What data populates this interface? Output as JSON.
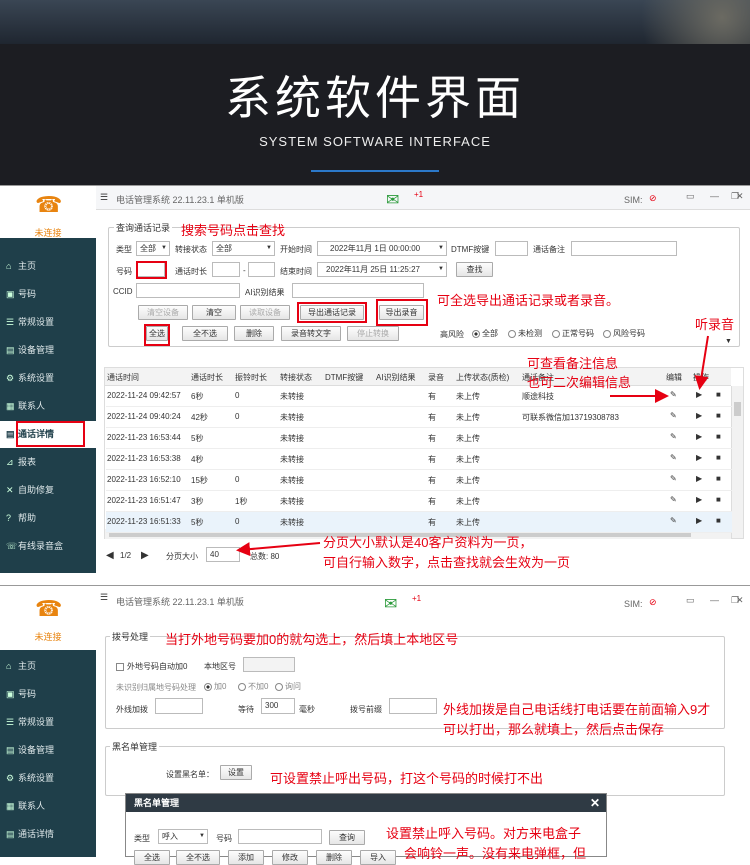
{
  "banner": {
    "title": "系统软件界面",
    "subtitle": "SYSTEM SOFTWARE INTERFACE"
  },
  "app": {
    "title": "电话管理系统  22.11.23.1  单机版",
    "msg_badge": "+1",
    "sim_label": "SIM:",
    "status": "未连接",
    "nav": [
      "主页",
      "号码",
      "常规设置",
      "设备管理",
      "系统设置",
      "联系人",
      "通话详情",
      "报表",
      "自助修复",
      "帮助",
      "有线录音盒"
    ]
  },
  "records": {
    "group_title": "查询通话记录",
    "type_label": "类型",
    "type_value": "全部",
    "transfer_label": "转接状态",
    "transfer_value": "全部",
    "start_label": "开始时间",
    "start_value": "2022年11月 1日 00:00:00",
    "dtmf_label": "DTMF按键",
    "note_label": "通话备注",
    "number_label": "号码",
    "duration_label": "通话时长",
    "dash": "-",
    "end_label": "结束时间",
    "end_value": "2022年11月 25日 11:25:27",
    "search_btn": "查找",
    "ccid_label": "CCID",
    "ai_label": "AI识别结果",
    "buttons": [
      "清空设备",
      "清空",
      "读取设备",
      "导出通话记录",
      "导出录音",
      "全选",
      "全不选",
      "删除",
      "录音转文字",
      "停止转换"
    ],
    "risk_label": "高风险",
    "risk_opts": [
      "全部",
      "未检测",
      "正常号码",
      "风险号码"
    ],
    "headers": [
      "通话时间",
      "通话时长",
      "振铃时长",
      "转接状态",
      "DTMF按键",
      "AI识别结果",
      "录音",
      "上传状态(质检)",
      "通话备注",
      "编辑",
      "操作"
    ],
    "rows": [
      [
        "2022-11-24 09:42:57",
        "6秒",
        "0",
        "未转接",
        "有",
        "未上传",
        "顺途科技"
      ],
      [
        "2022-11-24 09:40:24",
        "42秒",
        "0",
        "未转接",
        "有",
        "未上传",
        "可联系微信加13719308783"
      ],
      [
        "2022-11-23 16:53:44",
        "5秒",
        "",
        "未转接",
        "有",
        "未上传",
        ""
      ],
      [
        "2022-11-23 16:53:38",
        "4秒",
        "",
        "未转接",
        "有",
        "未上传",
        ""
      ],
      [
        "2022-11-23 16:52:10",
        "15秒",
        "0",
        "未转接",
        "有",
        "未上传",
        ""
      ],
      [
        "2022-11-23 16:51:47",
        "3秒",
        "1秒",
        "未转接",
        "有",
        "未上传",
        ""
      ],
      [
        "2022-11-23 16:51:33",
        "5秒",
        "0",
        "未转接",
        "有",
        "未上传",
        ""
      ]
    ],
    "page": "1/2",
    "page_size_label": "分页大小",
    "page_size": "40",
    "total": "总数:  80"
  },
  "annotations1": {
    "search": "搜索号码点击查找",
    "export": "可全选导出通话记录或者录音。",
    "listen": "听录音",
    "note1": "可查看备注信息",
    "note2": "也可二次编辑信息",
    "page1": "分页大小默认是40客户资料为一页，",
    "page2": "可自行输入数字，点击查找就会生效为一页"
  },
  "dial": {
    "group_title": "拨号处理",
    "auto_zero": "外地号码自动加0",
    "area_label": "本地区号",
    "unknown_label": "未识别归属地号码处理",
    "unknown_opts": [
      "加0",
      "不加0",
      "询问"
    ],
    "outside_label": "外线加拨",
    "wait_label": "等待",
    "wait_value": "300",
    "ms_label": "毫秒",
    "prefix_label": "拨号前缀",
    "blacklist_group": "黑名单管理",
    "blacklist_label": "设置黑名单：",
    "blacklist_btn": "设置"
  },
  "annotations2": {
    "zero": "当打外地号码要加0的就勾选上，然后填上本地区号",
    "outside1": "外线加拨是自己电话线打电话要在前面输入9才",
    "outside2": "可以打出，那么就填上，然后点击保存",
    "blacklist": "可设置禁止呼出号码，打这个号码的时候打不出",
    "incoming1": "设置禁止呼入号码。对方来电盒子",
    "incoming2": "会响铃一声。没有来电弹框，但"
  },
  "dialog": {
    "title": "黑名单管理",
    "type_label": "类型",
    "type_value": "呼入",
    "number_label": "号码",
    "search_btn": "查询",
    "buttons": [
      "全选",
      "全不选",
      "添加",
      "修改",
      "删除",
      "导入"
    ]
  }
}
